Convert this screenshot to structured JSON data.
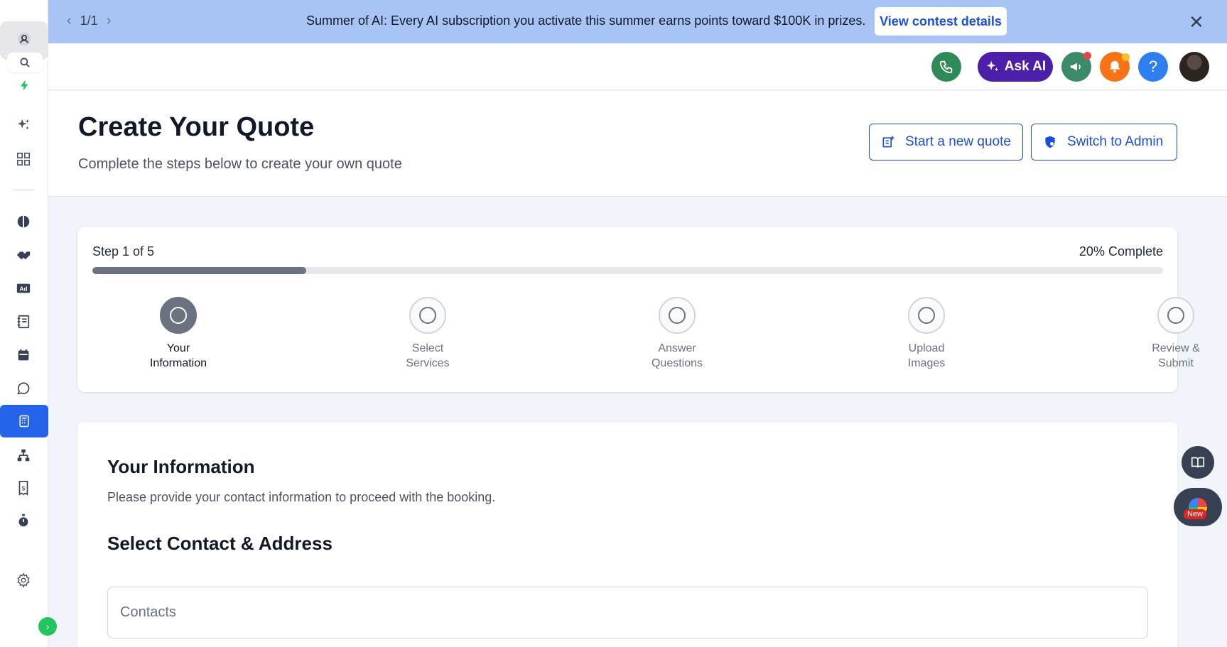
{
  "banner": {
    "page_indicator": "1/1",
    "prev_arrow": "‹",
    "next_arrow": "›",
    "message": "Summer of AI: Every AI subscription you activate this summer earns points toward $100K in prizes.",
    "cta_label": "View contest details",
    "close_glyph": "✕",
    "background_color": "#a8c4f5"
  },
  "topbar": {
    "ask_ai_label": "Ask AI",
    "help_glyph": "?",
    "colors": {
      "phone": "#2e8b57",
      "ask_ai": "#4c1fa8",
      "megaphone": "#3d8a6b",
      "bell": "#f97316",
      "help": "#2f7ef0"
    }
  },
  "header": {
    "title": "Create Your Quote",
    "subtitle": "Complete the steps below to create your own quote",
    "new_quote_label": "Start a new quote",
    "switch_admin_label": "Switch to Admin"
  },
  "progress": {
    "step_text": "Step 1 of 5",
    "percent_text": "20% Complete",
    "percent_value": 0.2,
    "steps": [
      {
        "line1": "Your",
        "line2": "Information",
        "active": true
      },
      {
        "line1": "Select",
        "line2": "Services",
        "active": false
      },
      {
        "line1": "Answer",
        "line2": "Questions",
        "active": false
      },
      {
        "line1": "Upload",
        "line2": "Images",
        "active": false
      },
      {
        "line1": "Review &",
        "line2": "Submit",
        "active": false
      }
    ]
  },
  "info": {
    "title": "Your Information",
    "subtitle": "Please provide your contact information to proceed with the booking.",
    "section_title": "Select Contact & Address",
    "contacts_placeholder": "Contacts"
  },
  "floating": {
    "new_badge": "New"
  },
  "sidebar": {
    "accent_color": "#2563eb",
    "icons": [
      "user-icon",
      "search-icon",
      "bolt-icon",
      "sparkles-icon",
      "grid-icon",
      "pie-icon",
      "handshake-icon",
      "ad-icon",
      "notebook-icon",
      "calendar-icon",
      "chat-icon",
      "quote-calculator-icon",
      "sitemap-icon",
      "invoice-icon",
      "stopwatch-icon",
      "settings-icon",
      "expand-icon"
    ]
  }
}
